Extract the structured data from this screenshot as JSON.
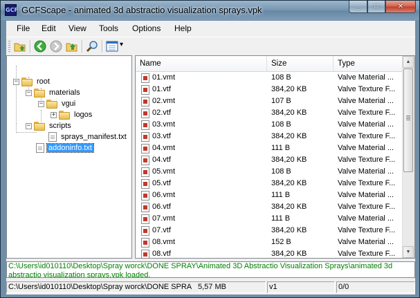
{
  "window": {
    "title": "GCFScape - animated 3d abstractio visualization sprays.vpk",
    "app_icon_text": "GCF"
  },
  "window_controls": {
    "minimize": "_",
    "maximize": "□",
    "close": "✕"
  },
  "menu": [
    "File",
    "Edit",
    "View",
    "Tools",
    "Options",
    "Help"
  ],
  "toolbar": {
    "buttons": [
      "open-icon",
      "back-icon",
      "forward-icon",
      "up-icon",
      "find-icon",
      "view-icon"
    ],
    "view_dropdown_arrow": "▾"
  },
  "tree": {
    "root": "root",
    "materials": "materials",
    "vgui": "vgui",
    "logos": "logos",
    "scripts": "scripts",
    "sprays_manifest": "sprays_manifest.txt",
    "addoninfo": "addoninfo.txt",
    "expanders": {
      "root": "−",
      "materials": "−",
      "vgui": "−",
      "logos": "+",
      "scripts": "−"
    }
  },
  "list": {
    "columns": {
      "name": "Name",
      "size": "Size",
      "type": "Type"
    },
    "rows": [
      {
        "name": "01.vmt",
        "size": "108 B",
        "type": "Valve Material ..."
      },
      {
        "name": "01.vtf",
        "size": "384,20 KB",
        "type": "Valve Texture F..."
      },
      {
        "name": "02.vmt",
        "size": "107 B",
        "type": "Valve Material ..."
      },
      {
        "name": "02.vtf",
        "size": "384,20 KB",
        "type": "Valve Texture F..."
      },
      {
        "name": "03.vmt",
        "size": "108 B",
        "type": "Valve Material ..."
      },
      {
        "name": "03.vtf",
        "size": "384,20 KB",
        "type": "Valve Texture F..."
      },
      {
        "name": "04.vmt",
        "size": "111 B",
        "type": "Valve Material ..."
      },
      {
        "name": "04.vtf",
        "size": "384,20 KB",
        "type": "Valve Texture F..."
      },
      {
        "name": "05.vmt",
        "size": "108 B",
        "type": "Valve Material ..."
      },
      {
        "name": "05.vtf",
        "size": "384,20 KB",
        "type": "Valve Texture F..."
      },
      {
        "name": "06.vmt",
        "size": "111 B",
        "type": "Valve Material ..."
      },
      {
        "name": "06.vtf",
        "size": "384,20 KB",
        "type": "Valve Texture F..."
      },
      {
        "name": "07.vmt",
        "size": "111 B",
        "type": "Valve Material ..."
      },
      {
        "name": "07.vtf",
        "size": "384,20 KB",
        "type": "Valve Texture F..."
      },
      {
        "name": "08.vmt",
        "size": "152 B",
        "type": "Valve Material ..."
      },
      {
        "name": "08.vtf",
        "size": "384,20 KB",
        "type": "Valve Texture F..."
      }
    ],
    "scroll": {
      "up": "▲",
      "down": "▼"
    }
  },
  "log": {
    "line1": "C:\\Users\\id010110\\Desktop\\Spray worck\\DONE SPRAY\\Animated 3D Abstractio Visualization Sprays\\animated 3d",
    "line2": "abstractio visualization sprays.vpk loaded."
  },
  "status": {
    "path": "C:\\Users\\id010110\\Desktop\\Spray worck\\DONE SPRA",
    "size": "5,57 MB",
    "version": "v1",
    "count": "0/0"
  },
  "colors": {
    "selection": "#3399ff",
    "log_text": "#008000",
    "titlebar": "#7a98b3"
  }
}
